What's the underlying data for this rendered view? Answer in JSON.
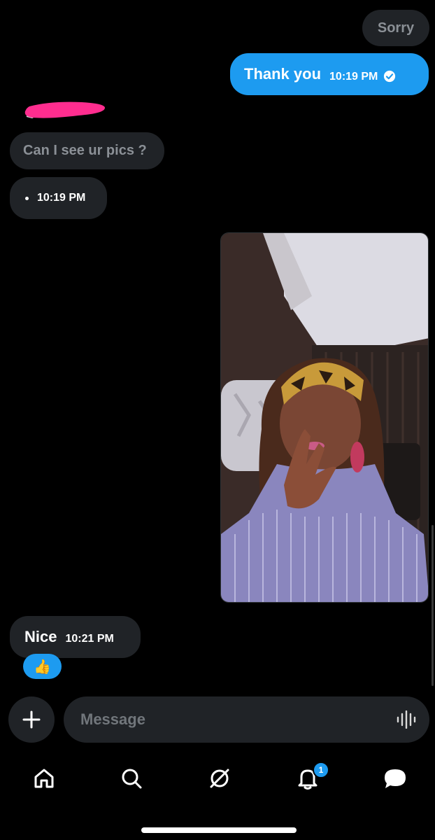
{
  "messages": {
    "sorry": "Sorry",
    "thanks": "Thank you",
    "thanks_time": "10:19 PM",
    "ask": "Can I see ur pics ?",
    "ask_time": "10:19 PM",
    "nice": "Nice",
    "nice_time": "10:21 PM",
    "reaction": "👍"
  },
  "composer": {
    "placeholder": "Message"
  },
  "nav": {
    "notification_count": "1"
  },
  "icons": [
    "plus-icon",
    "voice-icon",
    "home-icon",
    "search-icon",
    "grok-icon",
    "notifications-icon",
    "messages-icon",
    "check-icon"
  ],
  "colors": {
    "accent": "#1d9bf0",
    "bubble_grey": "#202327",
    "redaction": "#ff2d8f"
  }
}
